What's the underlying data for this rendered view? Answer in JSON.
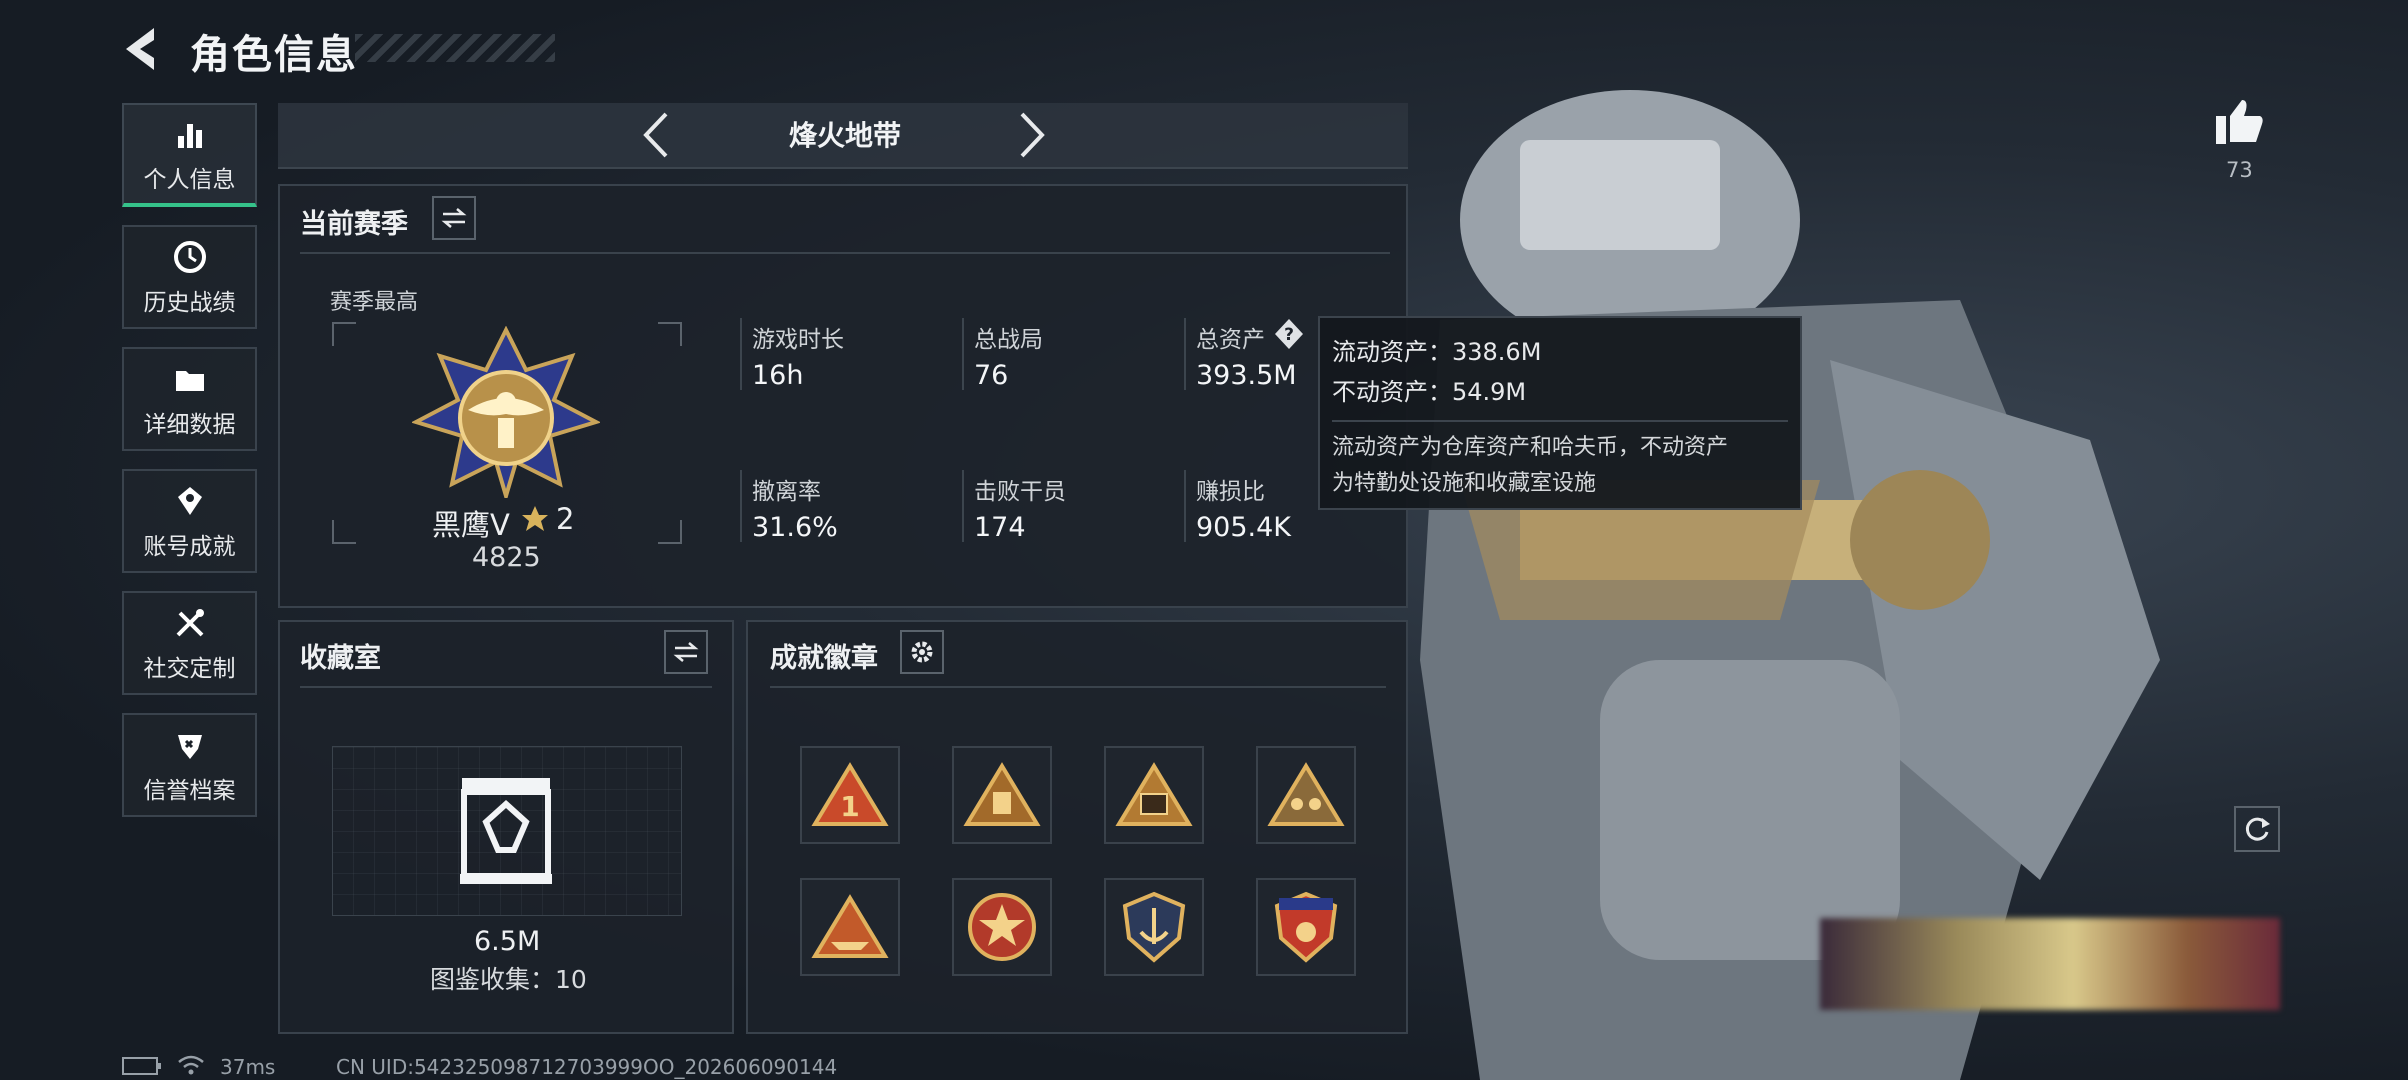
{
  "header": {
    "title": "角色信息"
  },
  "nav": [
    {
      "label": "个人信息",
      "icon": "bar-chart-icon",
      "active": true
    },
    {
      "label": "历史战绩",
      "icon": "clock-icon"
    },
    {
      "label": "详细数据",
      "icon": "folder-icon"
    },
    {
      "label": "账号成就",
      "icon": "trophy-icon"
    },
    {
      "label": "社交定制",
      "icon": "tools-icon"
    },
    {
      "label": "信誉档案",
      "icon": "shield-icon"
    }
  ],
  "mode_selector": {
    "label": "烽火地带"
  },
  "season": {
    "title": "当前赛季",
    "best_label": "赛季最高",
    "rank_name": "黑鹰Ⅴ",
    "rank_stars": "2",
    "rank_points": "4825",
    "stats": [
      {
        "label": "游戏时长",
        "value": "16h"
      },
      {
        "label": "总战局",
        "value": "76"
      },
      {
        "label": "总资产",
        "value": "393.5M"
      },
      {
        "label": "撤离率",
        "value": "31.6%"
      },
      {
        "label": "击败干员",
        "value": "174"
      },
      {
        "label": "赚损比",
        "value": "905.4K"
      }
    ]
  },
  "tooltip": {
    "liquid": "流动资产：338.6M",
    "fixed": "不动资产：54.9M",
    "desc_line1": "流动资产为仓库资产和哈夫币，不动资产",
    "desc_line2": "为特勤处设施和收藏室设施"
  },
  "collection": {
    "title": "收藏室",
    "value": "6.5M",
    "count_label": "图鉴收集：10"
  },
  "badges": {
    "title": "成就徽章"
  },
  "likes": {
    "count": "73"
  },
  "status": {
    "ping": "37ms",
    "uid": "CN UID:542325098712703999OO_202606090144"
  },
  "colors": {
    "accent": "#35c28a",
    "gold": "#c9a45a"
  }
}
